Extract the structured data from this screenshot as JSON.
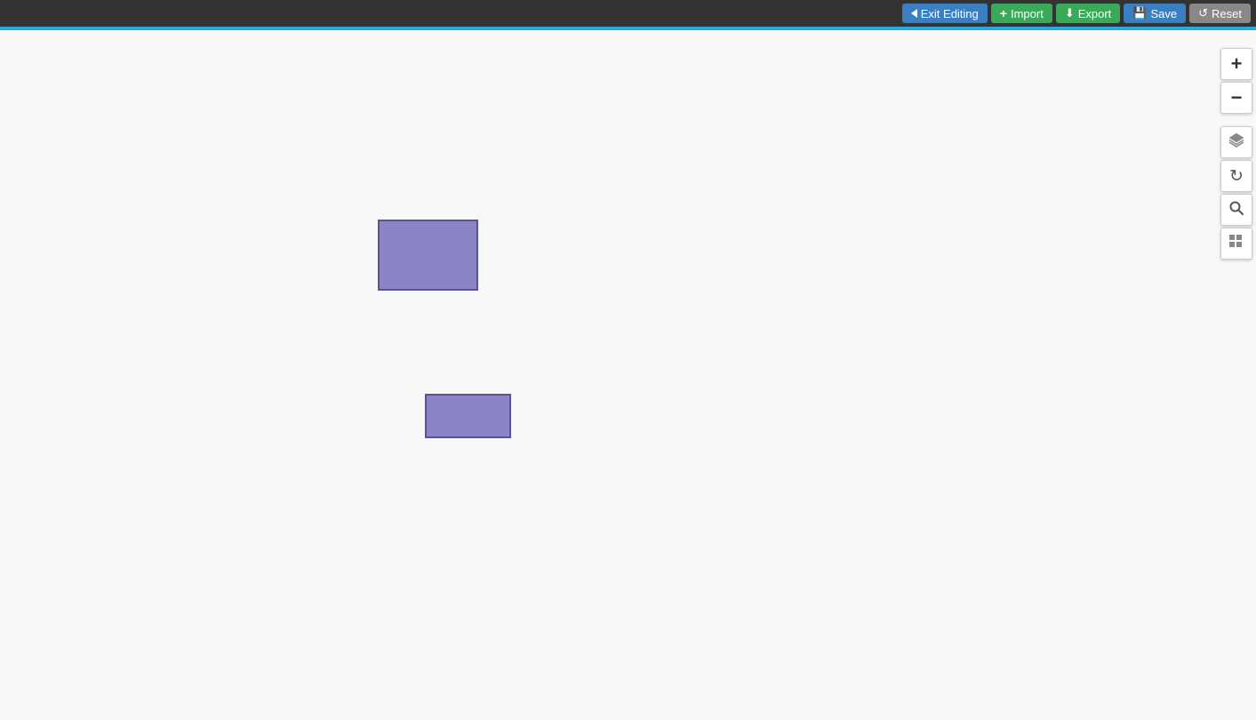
{
  "toolbar": {
    "exit_editing_label": "Exit Editing",
    "import_label": "Import",
    "export_label": "Export",
    "save_label": "Save",
    "reset_label": "Reset"
  },
  "map": {
    "rect1": {
      "color": "#8b84c7",
      "border_color": "#5a5490"
    },
    "rect2": {
      "color": "#8b84c7",
      "border_color": "#5a5490"
    }
  },
  "controls": {
    "zoom_in_label": "+",
    "zoom_out_label": "−",
    "layers_icon": "layers",
    "refresh_icon": "refresh",
    "search_icon": "search",
    "grid_icon": "grid"
  }
}
